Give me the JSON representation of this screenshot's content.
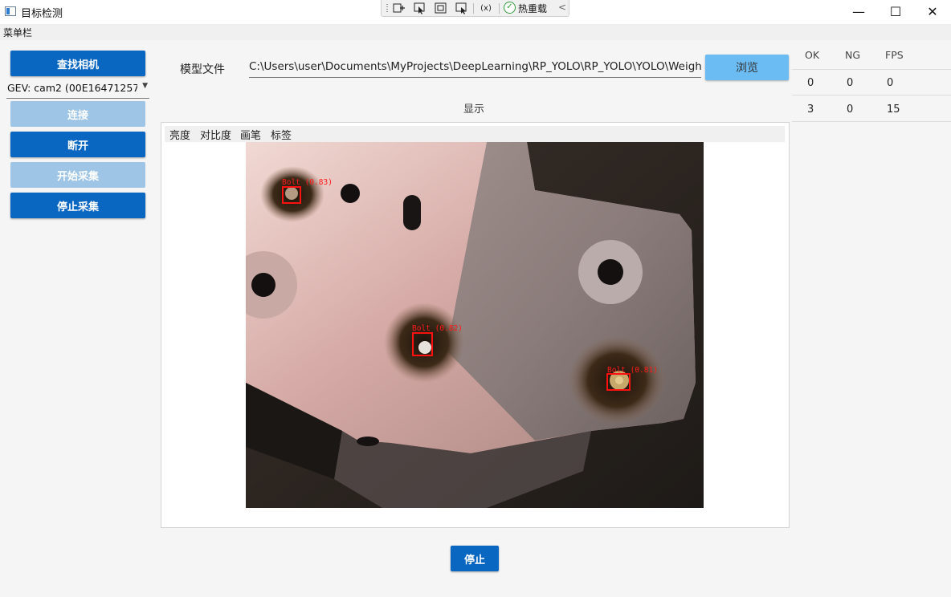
{
  "window": {
    "title": "目标检测",
    "minimize_glyph": "—",
    "maximize_glyph": "☐",
    "close_glyph": "✕"
  },
  "dev_toolbar": {
    "hot_reload_label": "热重载"
  },
  "menubar": {
    "label": "菜单栏"
  },
  "camera_panel": {
    "find_camera_label": "查找相机",
    "camera_selected": "GEV: cam2 (00E16471257",
    "connect_label": "连接",
    "disconnect_label": "断开",
    "start_capture_label": "开始采集",
    "stop_capture_label": "停止采集"
  },
  "model": {
    "label": "模型文件",
    "path": "C:\\Users\\user\\Documents\\MyProjects\\DeepLearning\\RP_YOLO\\RP_YOLO\\YOLO\\Weights\\",
    "browse_label": "浏览"
  },
  "display": {
    "title": "显示",
    "tools": [
      "亮度",
      "对比度",
      "画笔",
      "标签"
    ],
    "detections": [
      {
        "label": "Bolt (0.83)"
      },
      {
        "label": "Bolt (0.82)"
      },
      {
        "label": "Bolt (0.81)"
      }
    ]
  },
  "stats": {
    "headers": [
      "OK",
      "NG",
      "FPS"
    ],
    "rows": [
      [
        "0",
        "0",
        "0"
      ],
      [
        "3",
        "0",
        "15"
      ]
    ]
  },
  "bottom": {
    "stop_label": "停止"
  },
  "colors": {
    "primary": "#0a67c1",
    "disabled": "#9ec5e6",
    "browse": "#6cbcf4",
    "detection": "#ff1010"
  }
}
